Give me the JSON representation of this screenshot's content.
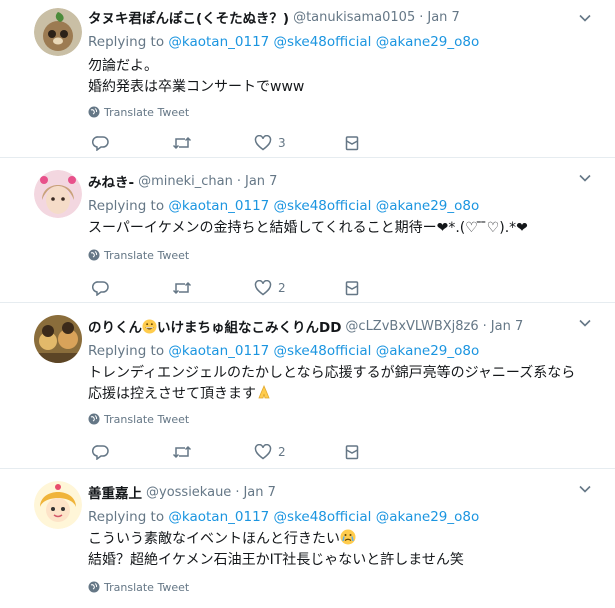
{
  "colors": {
    "accent": "#1b95e0",
    "muted": "#657786",
    "border": "#e6ecf0"
  },
  "icons": [
    "reply-icon",
    "retweet-icon",
    "like-icon",
    "direct-message-icon",
    "globe-icon",
    "chevron-down-icon"
  ],
  "tweets": [
    {
      "name": "タヌキ君ぽんぽこ(くそたぬき？)",
      "handle": "@tanukisama0105",
      "dot": "·",
      "time": "Jan 7",
      "replying_label": "Replying to",
      "mentions": [
        "@kaotan_0117",
        "@ske48official",
        "@akane29_o8o"
      ],
      "lines": [
        "勿論だよ。",
        "婚約発表は卒業コンサートでwww"
      ],
      "translate_label": "Translate Tweet",
      "reply_count": "",
      "retweet_count": "",
      "like_count": "3"
    },
    {
      "name": "みねき-",
      "handle": "@mineki_chan",
      "dot": "·",
      "time": "Jan 7",
      "replying_label": "Replying to",
      "mentions": [
        "@kaotan_0117",
        "@ske48official",
        "@akane29_o8o"
      ],
      "lines": [
        "スーパーイケメンの金持ちと結婚してくれること期待ー❤*.(♡ ̄ ̄♡).*❤"
      ],
      "translate_label": "Translate Tweet",
      "reply_count": "",
      "retweet_count": "",
      "like_count": "2"
    },
    {
      "name": "のりくん",
      "name_suffix": "いけまちゅ組なこみくりんDD",
      "handle": "@cLZvBxVLWBXj8z6",
      "dot": "·",
      "time": "Jan 7",
      "replying_label": "Replying to",
      "mentions": [
        "@kaotan_0117",
        "@ske48official",
        "@akane29_o8o"
      ],
      "lines": [
        "トレンディエンジェルのたかしとなら応援するが錦戸亮等のジャニーズ系なら",
        "応援は控えさせて頂きます"
      ],
      "translate_label": "Translate Tweet",
      "reply_count": "",
      "retweet_count": "",
      "like_count": "2"
    },
    {
      "name": "善重嘉上",
      "handle": "@yossiekaue",
      "dot": "·",
      "time": "Jan 7",
      "replying_label": "Replying to",
      "mentions": [
        "@kaotan_0117",
        "@ske48official",
        "@akane29_o8o"
      ],
      "lines": [
        "こういう素敵なイベントほんと行きたい",
        "結婚？超絶イケメン石油王かIT社長じゃないと許しません笑"
      ],
      "translate_label": "Translate Tweet"
    }
  ]
}
